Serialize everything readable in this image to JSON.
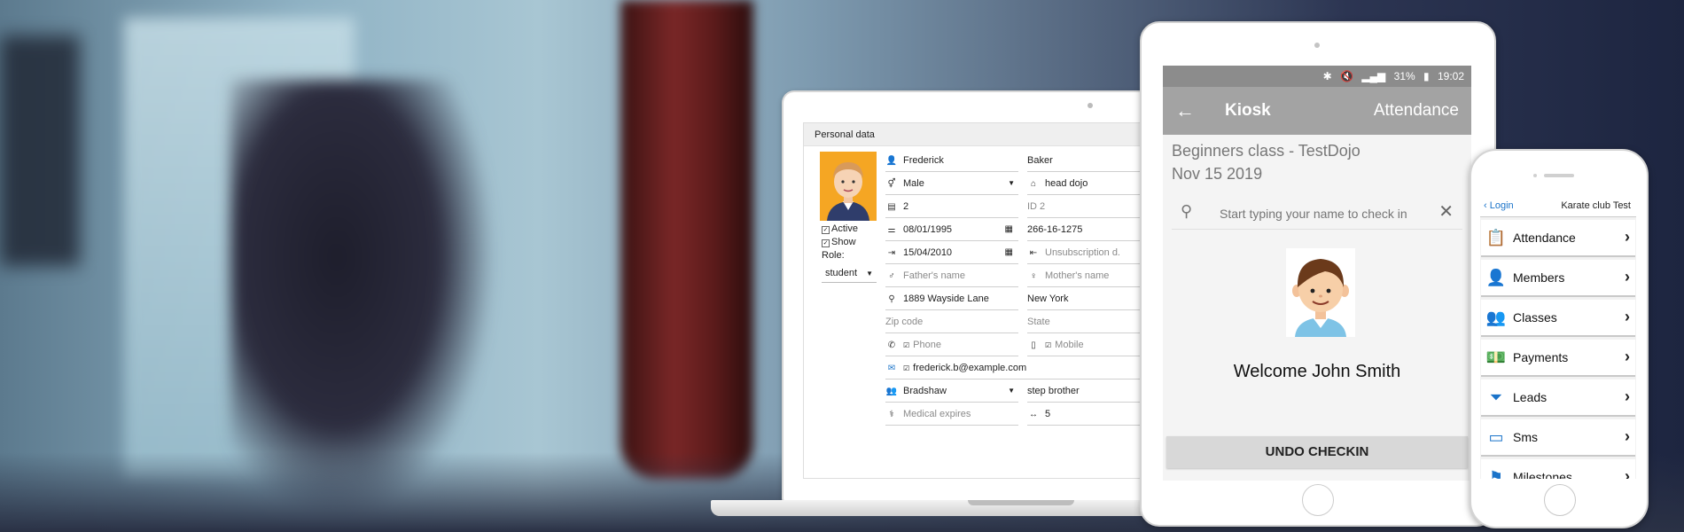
{
  "laptop": {
    "panel_title": "Personal data",
    "left": {
      "active_label": "Active",
      "show_label": "Show",
      "role_label": "Role:",
      "role_value": "student"
    },
    "rows": [
      {
        "a": "Frederick",
        "b": "Baker"
      },
      {
        "a": "Male",
        "b": "head dojo"
      },
      {
        "a": "2",
        "b": "ID 2"
      },
      {
        "a": "08/01/1995",
        "b": "266-16-1275"
      },
      {
        "a": "15/04/2010",
        "b": "Unsubscription d."
      },
      {
        "a": "Father's name",
        "b": "Mother's name"
      },
      {
        "a": "1889 Wayside Lane",
        "b": "New York"
      },
      {
        "a": "Zip code",
        "b": "State"
      },
      {
        "a": "Phone",
        "b": "Mobile"
      },
      {
        "a": "frederick.b@example.com"
      },
      {
        "a": "Bradshaw",
        "b": "step brother"
      },
      {
        "a": "Medical expires",
        "b": "5"
      }
    ]
  },
  "tablet": {
    "status": {
      "battery": "31%",
      "time": "19:02"
    },
    "appbar": {
      "title": "Kiosk",
      "right": "Attendance"
    },
    "class_name": "Beginners class - TestDojo",
    "class_date": "Nov 15 2019",
    "search_placeholder": "Start typing your name to check in",
    "welcome": "Welcome John Smith",
    "undo_label": "UNDO CHECKIN"
  },
  "phone": {
    "login_label": "Login",
    "club_name": "Karate club Test",
    "menu": [
      {
        "label": "Attendance",
        "icon": "clipboard-icon"
      },
      {
        "label": "Members",
        "icon": "person-icon"
      },
      {
        "label": "Classes",
        "icon": "group-icon"
      },
      {
        "label": "Payments",
        "icon": "money-icon"
      },
      {
        "label": "Leads",
        "icon": "funnel-icon"
      },
      {
        "label": "Sms",
        "icon": "chat-icon"
      },
      {
        "label": "Milestones",
        "icon": "flag-icon"
      }
    ]
  },
  "colors": {
    "accent_blue": "#1a73c9",
    "avatar_bg": "#f5a623",
    "appbar": "#a3a3a3"
  }
}
